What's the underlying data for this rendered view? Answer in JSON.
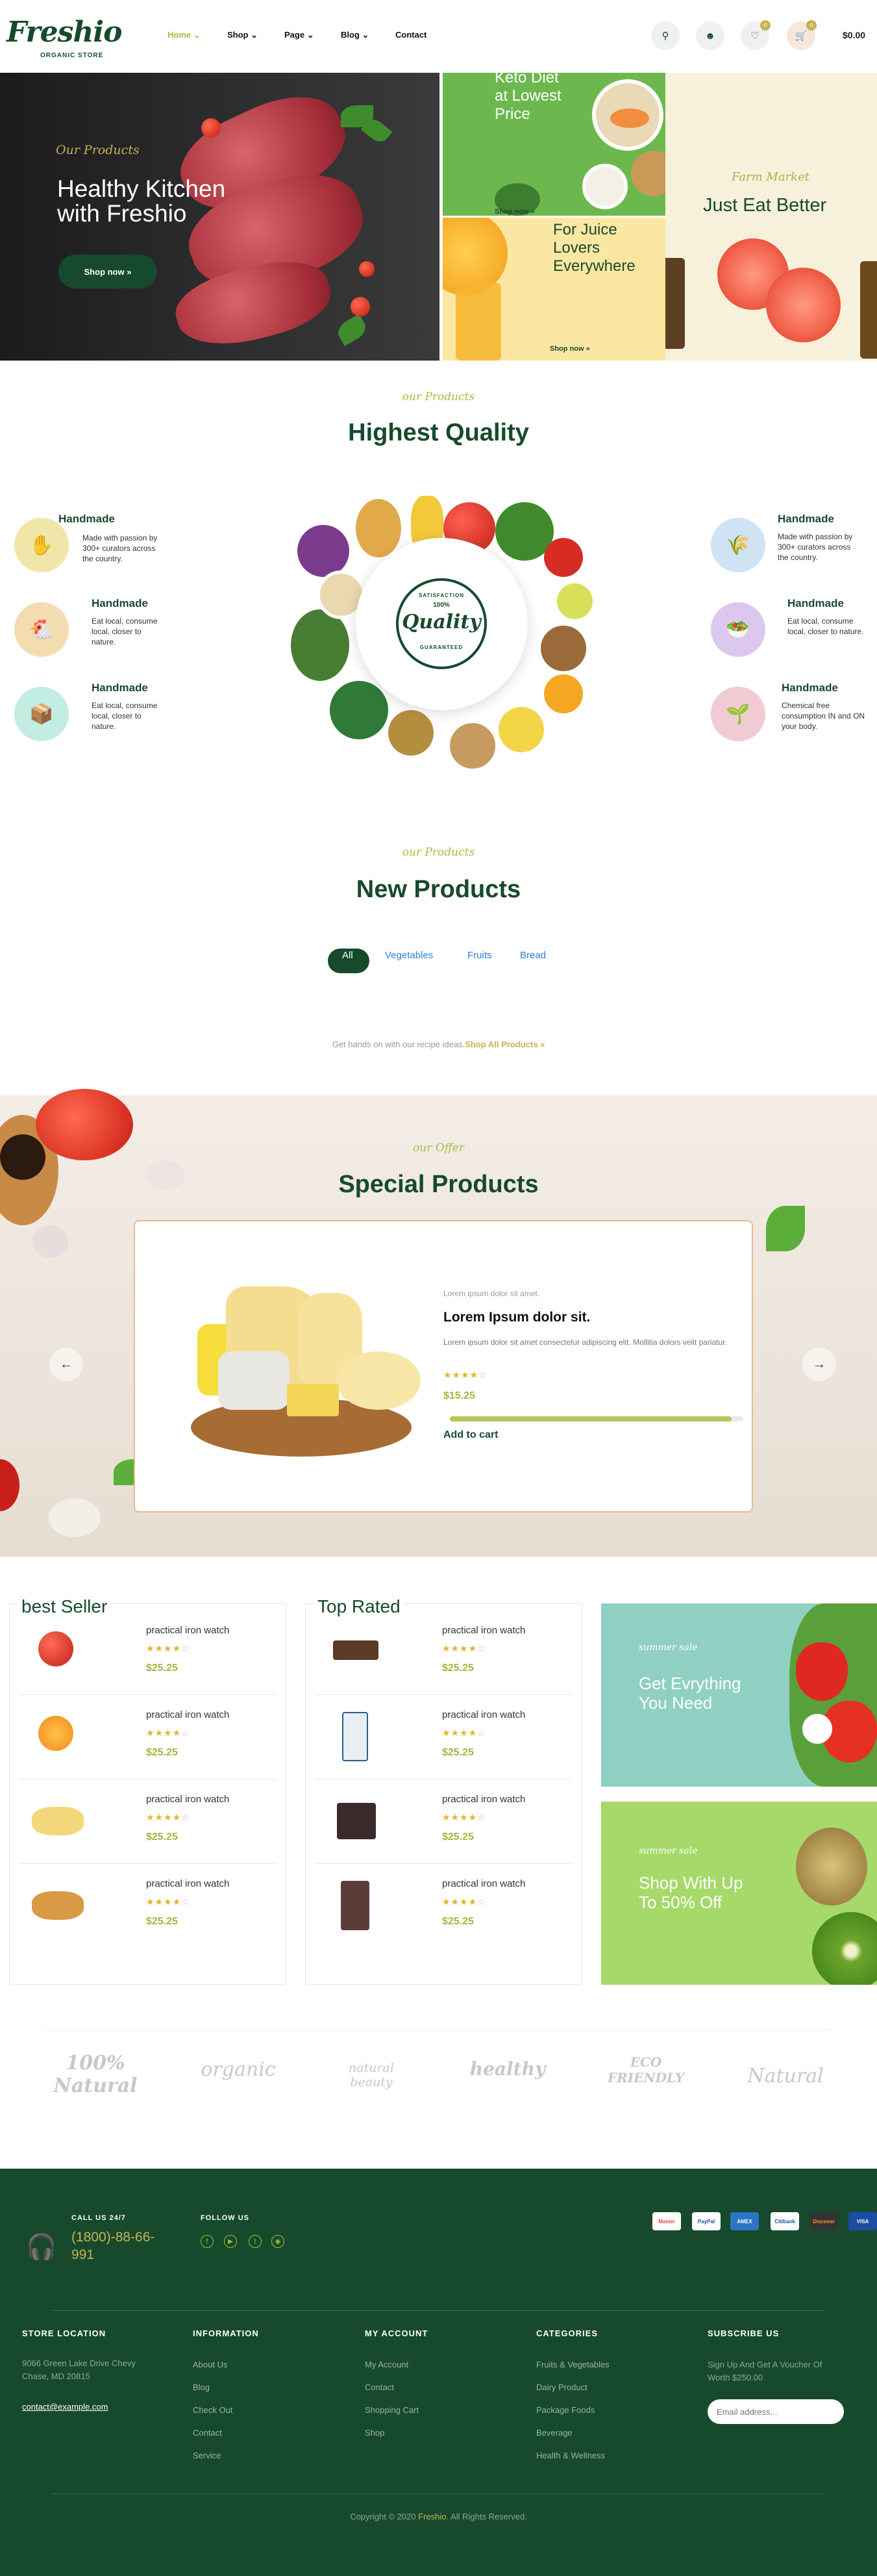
{
  "header": {
    "logo": "Freshio",
    "logo_tagline": "ORGANIC STORE",
    "nav": [
      "Home",
      "Shop",
      "Page",
      "Blog",
      "Contact"
    ],
    "wishlist_count": "0",
    "cart_count": "0",
    "cart_total": "$0.00"
  },
  "hero": {
    "main": {
      "script": "Our Products",
      "title_line1": "Healthy Kitchen",
      "title_line2": "with Freshio",
      "button": "Shop now »"
    },
    "tile_keto": {
      "line1": "Keto Diet",
      "line2": "at Lowest",
      "line3": "Price",
      "button": "Shop now »"
    },
    "tile_juice": {
      "line1": "For Juice",
      "line2": "Lovers",
      "line3": "Everywhere",
      "button": "Shop now »"
    },
    "tile_farm": {
      "script": "Farm Market",
      "title": "Just Eat Better"
    }
  },
  "quality": {
    "script": "our Products",
    "title": "Highest Quality",
    "badge_top": "SATISFACTION",
    "badge_main": "Quality",
    "badge_sub": "GUARANTEED",
    "badge_pct": "100%",
    "features_left": [
      {
        "title": "Handmade",
        "text": "Made with passion by 300+ curators across the country."
      },
      {
        "title": "Handmade",
        "text": "Eat local, consume local, closer to nature."
      },
      {
        "title": "Handmade",
        "text": "Eat local, consume local, closer to nature."
      }
    ],
    "features_right": [
      {
        "title": "Handmade",
        "text": "Made with passion by 300+ curators across the country."
      },
      {
        "title": "Handmade",
        "text": "Eat local, consume local, closer to nature."
      },
      {
        "title": "Handmade",
        "text": "Chemical free consumption IN and ON your body."
      }
    ]
  },
  "new_products": {
    "script": "our Products",
    "title": "New Products",
    "filters": [
      "All",
      "Vegetables",
      "Fruits",
      "Bread"
    ],
    "note": "Get hands on with our recipe ideas.",
    "note_link": "Shop All Products »"
  },
  "special": {
    "script": "our Offer",
    "title": "Special Products",
    "product": {
      "subtitle": "Lorem ipsum dolor sit amet.",
      "name": "Lorem Ipsum dolor sit.",
      "desc": "Lorem ipsum dolor sit amet consectetur adipiscing elit. Mollitia dolors velit pariatur.",
      "rating": 4,
      "price": "$15.25",
      "progress": 0.96,
      "cta": "Add to cart"
    }
  },
  "best_seller": {
    "title": "best Seller",
    "items": [
      {
        "name": "practical iron watch",
        "price": "$25.25",
        "rating": 4
      },
      {
        "name": "practical iron watch",
        "price": "$25.25",
        "rating": 4
      },
      {
        "name": "practical iron watch",
        "price": "$25.25",
        "rating": 4
      },
      {
        "name": "practical iron watch",
        "price": "$25.25",
        "rating": 4
      }
    ]
  },
  "top_rated": {
    "title": "Top Rated",
    "items": [
      {
        "name": "practical iron watch",
        "price": "$25.25",
        "rating": 4
      },
      {
        "name": "practical iron watch",
        "price": "$25.25",
        "rating": 4
      },
      {
        "name": "practical iron watch",
        "price": "$25.25",
        "rating": 4
      },
      {
        "name": "practical iron watch",
        "price": "$25.25",
        "rating": 4
      }
    ]
  },
  "promos": [
    {
      "script": "summer sale",
      "line1": "Get Evrything",
      "line2": "You Need"
    },
    {
      "script": "summer sale",
      "line1": "Shop With Up",
      "line2": "To 50% Off"
    }
  ],
  "brands": [
    "100% Natural",
    "organic",
    "natural beauty",
    "healthy",
    "ECO FRIENDLY",
    "Natural"
  ],
  "footer": {
    "call_label": "CALL US 24/7",
    "phone_line1": "(1800)-88-66-",
    "phone_line2": "991",
    "follow_label": "FOLLOW US",
    "payments": [
      "Master",
      "PayPal",
      "AMEX",
      "Citibank",
      "Discover",
      "VISA"
    ],
    "columns": [
      {
        "head": "STORE LOCATION",
        "links": [
          "9066 Green Lake Drive Chevy",
          "Chase, MD 20815"
        ],
        "email": "contact@example.com"
      },
      {
        "head": "INFORMATION",
        "links": [
          "About Us",
          "Blog",
          "Check Out",
          "Contact",
          "Service"
        ]
      },
      {
        "head": "MY ACCOUNT",
        "links": [
          "My Account",
          "Contact",
          "Shopping Cart",
          "Shop"
        ]
      },
      {
        "head": "CATEGORIES",
        "links": [
          "Fruits & Vegetables",
          "Dairy Product",
          "Package Foods",
          "Beverage",
          "Health & Wellness"
        ]
      },
      {
        "head": "SUBSCRIBE US",
        "links": [
          "Sign Up And Get A Voucher Of",
          "Worth $250.00"
        ],
        "placeholder": "Email address..."
      }
    ],
    "copyright_pre": "Copyright © 2020 ",
    "copyright_brand": "Freshio",
    "copyright_post": ". All Rights Reserved."
  },
  "colors": {
    "brand": "#174a2c",
    "accent": "#9fc13c",
    "gold": "#c6b34f"
  }
}
